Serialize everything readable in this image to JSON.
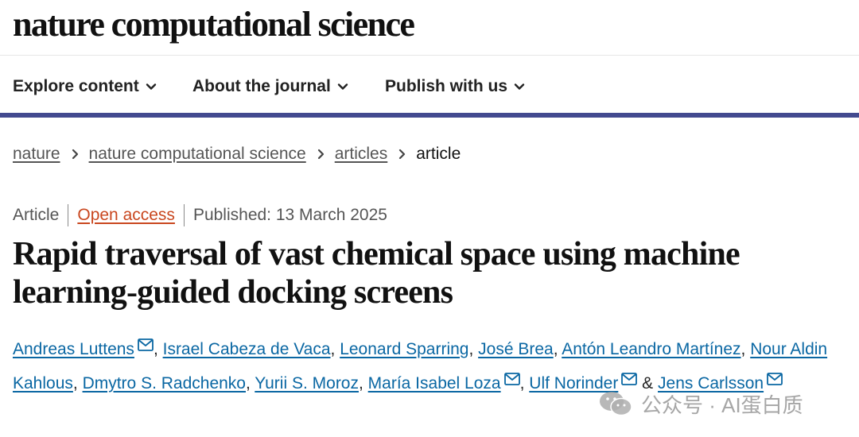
{
  "brand": {
    "logo_text": "nature computational science"
  },
  "nav": {
    "items": [
      {
        "label": "Explore content"
      },
      {
        "label": "About the journal"
      },
      {
        "label": "Publish with us"
      }
    ]
  },
  "breadcrumb": {
    "items": [
      "nature",
      "nature computational science",
      "articles"
    ],
    "current": "article"
  },
  "meta": {
    "type": "Article",
    "access": "Open access",
    "published": "Published: 13 March 2025"
  },
  "article": {
    "title": "Rapid traversal of vast chemical space using machine learning-guided docking screens"
  },
  "authors": {
    "list": [
      "Andreas Luttens",
      "Israel Cabeza de Vaca",
      "Leonard Sparring",
      "José Brea",
      "Antón Leandro Martínez",
      "Nour Aldin Kahlous",
      "Dmytro S. Radchenko",
      "Yurii S. Moroz",
      "María Isabel Loza",
      "Ulf Norinder",
      "Jens Carlsson"
    ],
    "comma": ", ",
    "ampersand": " & "
  },
  "watermark": {
    "text": "公众号 · AI蛋白质"
  },
  "colors": {
    "nav_border": "#434a8f",
    "author_link": "#0a67a3",
    "open_access": "#c9471f"
  },
  "icons": {
    "nav_dropdown": "chevron-down-icon",
    "breadcrumb_separator": "chevron-right-icon",
    "author_contact": "mail-icon",
    "watermark_logo": "wechat-icon"
  }
}
